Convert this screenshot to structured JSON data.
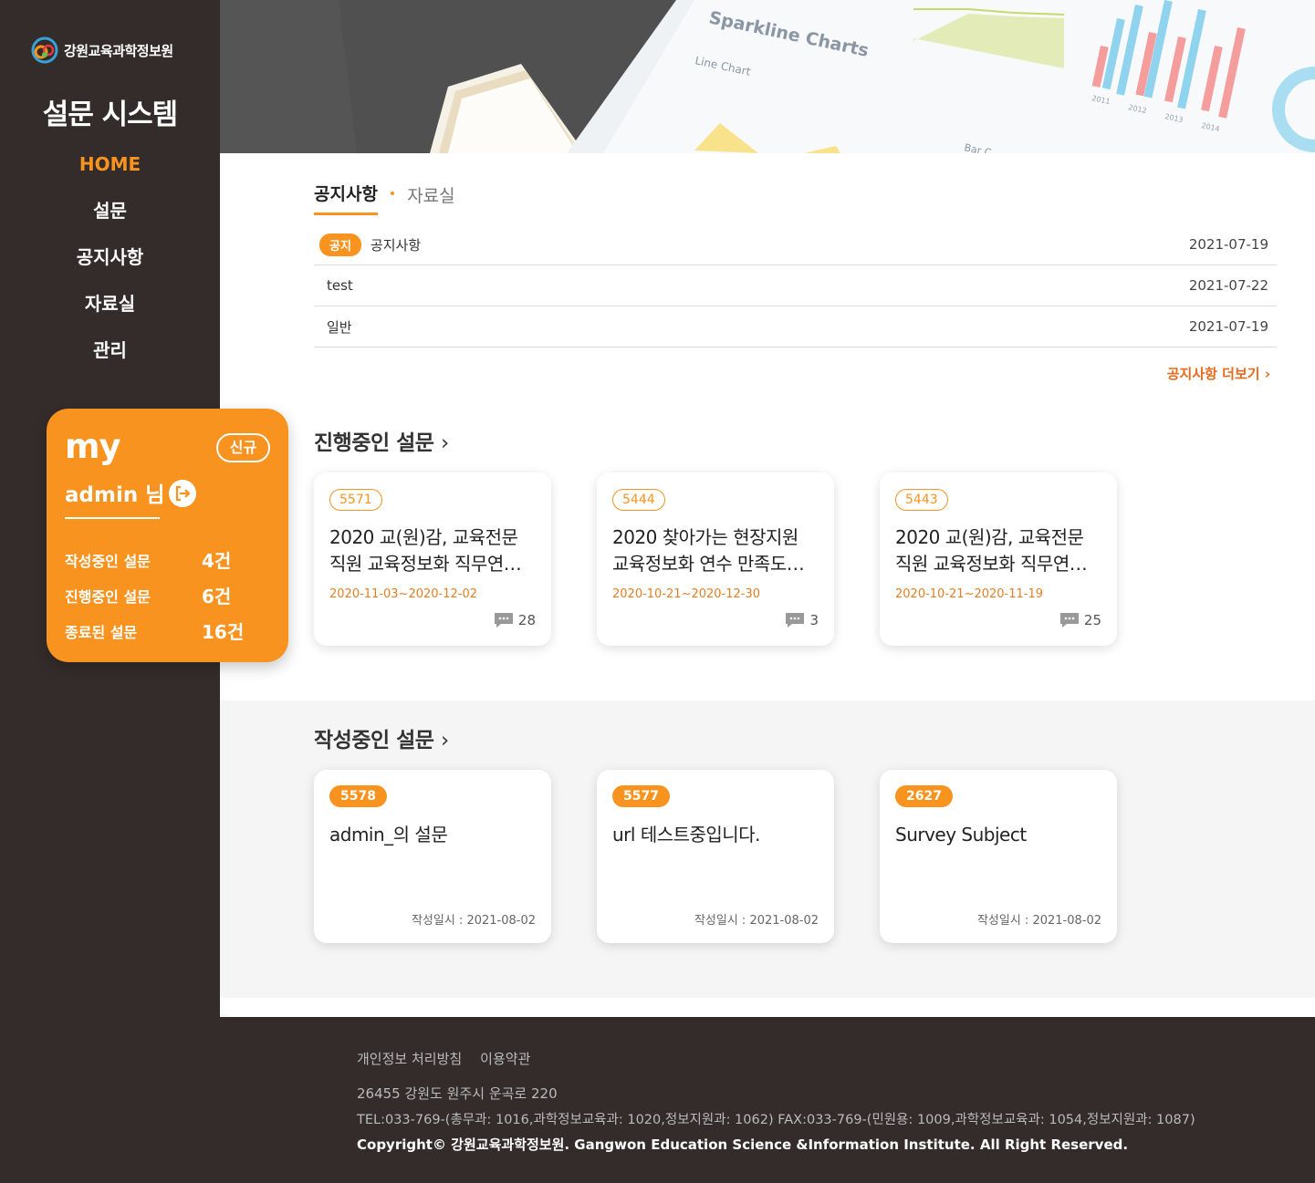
{
  "sidebar": {
    "logo_text": "강원교육과학정보원",
    "site_title": "설문 시스템",
    "nav": [
      {
        "label": "HOME",
        "active": true
      },
      {
        "label": "설문"
      },
      {
        "label": "공지사항"
      },
      {
        "label": "자료실"
      },
      {
        "label": "관리"
      }
    ]
  },
  "my": {
    "title": "my",
    "new_badge": "신규",
    "user": "admin 님",
    "stats": [
      {
        "label": "작성중인 설문",
        "value": "4건"
      },
      {
        "label": "진행중인 설문",
        "value": "6건"
      },
      {
        "label": "종료된 설문",
        "value": "16건"
      }
    ]
  },
  "hero": {
    "chart_title": "Sparkline Charts",
    "chart_subtitle": "Line Chart",
    "bar_label": "Bar C",
    "years": [
      "2011",
      "2012",
      "2013",
      "2014"
    ]
  },
  "notices": {
    "tabs": [
      "공지사항",
      "자료실"
    ],
    "items": [
      {
        "badge": "공지",
        "title": "공지사항",
        "date": "2021-07-19"
      },
      {
        "badge": "",
        "title": "test",
        "date": "2021-07-22"
      },
      {
        "badge": "",
        "title": "일반",
        "date": "2021-07-19"
      }
    ],
    "more": "공지사항 더보기"
  },
  "ongoing": {
    "title": "진행중인 설문",
    "cards": [
      {
        "id": "5571",
        "title1": "2020 교(원)감, 교육전문",
        "title2": "직원 교육정보화 직무연…",
        "period": "2020-11-03~2020-12-02",
        "comments": "28"
      },
      {
        "id": "5444",
        "title1": "2020 찾아가는 현장지원",
        "title2": "교육정보화 연수 만족도…",
        "period": "2020-10-21~2020-12-30",
        "comments": "3"
      },
      {
        "id": "5443",
        "title1": "2020 교(원)감, 교육전문",
        "title2": "직원 교육정보화 직무연…",
        "period": "2020-10-21~2020-11-19",
        "comments": "25"
      }
    ]
  },
  "drafts": {
    "title": "작성중인 설문",
    "cards": [
      {
        "id": "5578",
        "title": "admin_의 설문",
        "written": "작성일시 : 2021-08-02"
      },
      {
        "id": "5577",
        "title": "url 테스트중입니다.",
        "written": "작성일시 : 2021-08-02"
      },
      {
        "id": "2627",
        "title": "Survey Subject",
        "written": "작성일시 : 2021-08-02"
      }
    ]
  },
  "footer": {
    "links": [
      "개인정보 처리방침",
      "이용약관"
    ],
    "address": "26455 강원도 원주시 운곡로 220",
    "tel": "TEL:033-769-(총무과: 1016,과학정보교육과: 1020,정보지원과: 1062) FAX:033-769-(민원용: 1009,과학정보교육과: 1054,정보지원과: 1087)",
    "copyright": "Copyright© 강원교육과학정보원. Gangwon Education Science &Information Institute. All Right Reserved."
  },
  "colors": {
    "accent": "#f7931e",
    "sidebar": "#342c2a",
    "band": "#f5f5f5"
  }
}
